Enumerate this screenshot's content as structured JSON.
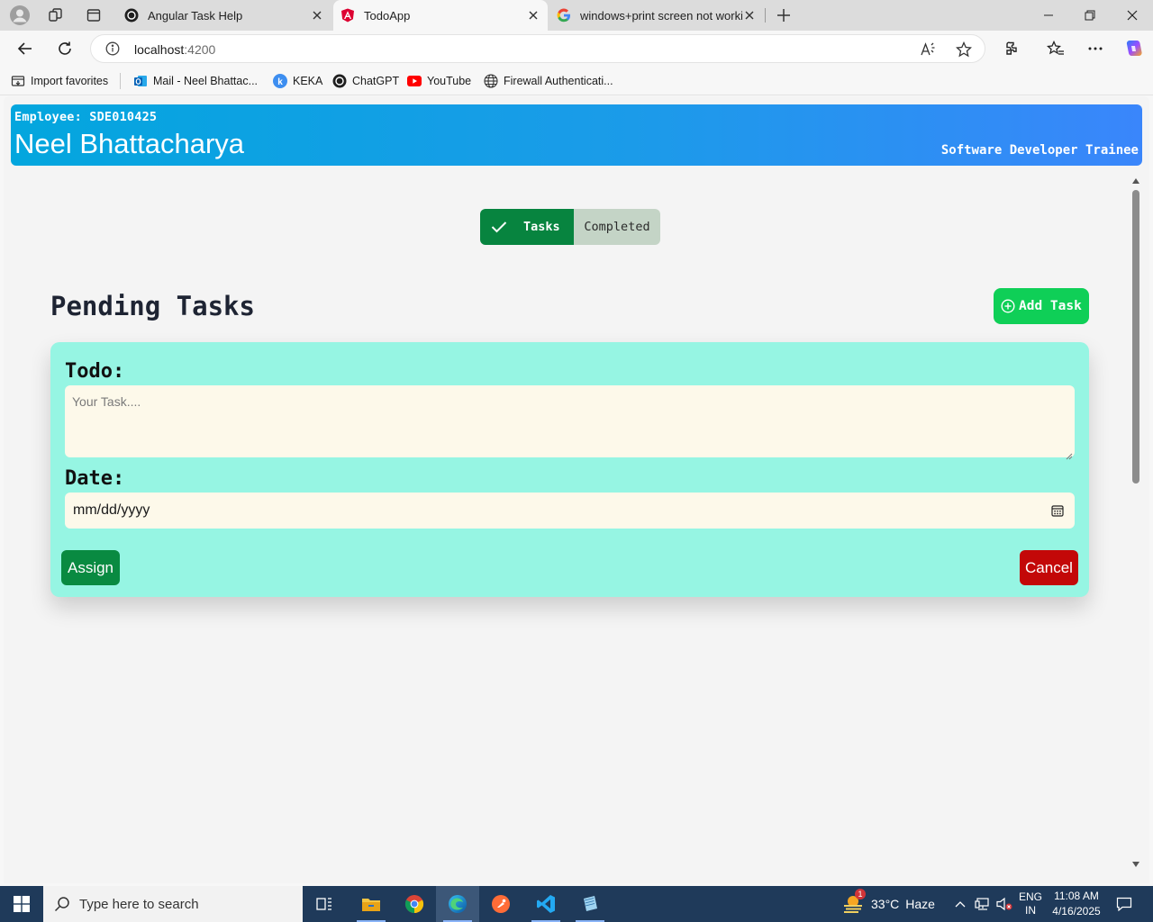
{
  "browser": {
    "tabs": [
      {
        "title": "Angular Task Help",
        "active": false
      },
      {
        "title": "TodoApp",
        "active": true
      },
      {
        "title": "windows+print screen not workin",
        "active": false
      }
    ],
    "address": {
      "host": "localhost",
      "port": ":4200"
    },
    "favorites": [
      {
        "label": "Import favorites",
        "icon": "import-favorites-icon"
      },
      {
        "label": "Mail - Neel Bhattac...",
        "icon": "outlook-icon"
      },
      {
        "label": "KEKA",
        "icon": "keka-icon"
      },
      {
        "label": "ChatGPT",
        "icon": "chatgpt-icon"
      },
      {
        "label": "YouTube",
        "icon": "youtube-icon"
      },
      {
        "label": "Firewall Authenticati...",
        "icon": "globe-icon"
      }
    ]
  },
  "header": {
    "employee_id": "Employee: SDE010425",
    "name": "Neel Bhattacharya",
    "role": "Software Developer Trainee"
  },
  "toggle": {
    "tasks_label": "Tasks",
    "completed_label": "Completed"
  },
  "main": {
    "title": "Pending Tasks",
    "add_task_label": "Add Task"
  },
  "form": {
    "todo_label": "Todo:",
    "todo_placeholder": "Your Task....",
    "date_label": "Date:",
    "date_placeholder": "mm/dd/yyyy",
    "assign_label": "Assign",
    "cancel_label": "Cancel"
  },
  "taskbar": {
    "search_placeholder": "Type here to search",
    "weather": {
      "badge": "1",
      "temp": "33°C",
      "condition": "Haze"
    },
    "language": {
      "lang": "ENG",
      "region": "IN"
    },
    "time": "11:08 AM",
    "date": "4/16/2025"
  },
  "colors": {
    "header_gradient_start": "#03a6de",
    "header_gradient_end": "#3a86fb",
    "tasks_active": "#07843f",
    "completed_inactive": "#c4d4c6",
    "add_task": "#0fcf57",
    "form_bg": "#96f5e3",
    "input_bg": "#fdf9ea",
    "assign": "#098a41",
    "cancel": "#c30808"
  }
}
